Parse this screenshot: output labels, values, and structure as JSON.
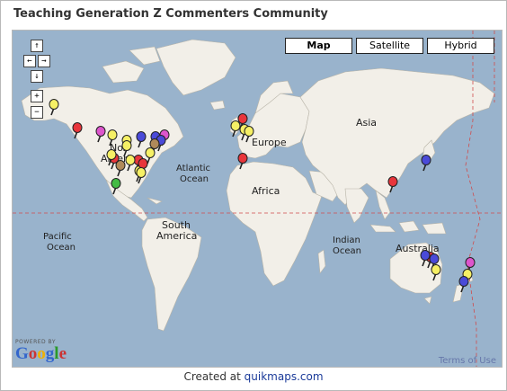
{
  "title": "Teaching Generation Z Commenters Community",
  "map_types": [
    "Map",
    "Satellite",
    "Hybrid"
  ],
  "active_map_type": "Map",
  "nav": {
    "up": "↑",
    "left": "←",
    "right": "→",
    "down": "↓",
    "zoom_in": "+",
    "zoom_out": "−"
  },
  "labels": {
    "asia": "Asia",
    "europe": "Europe",
    "africa": "Africa",
    "north_america_1": "No",
    "north_america_2": "America",
    "atlantic_1": "Atlantic",
    "atlantic_2": "Ocean",
    "pacific_1": "Pacific",
    "pacific_2": "Ocean",
    "south_america_1": "South",
    "south_america_2": "America",
    "indian_1": "Indian",
    "indian_2": "Ocean",
    "australia": "Australia"
  },
  "google": {
    "powered": "POWERED BY",
    "logo": "Google",
    "colors": [
      "#3366cc",
      "#cc3333",
      "#f0b000",
      "#3366cc",
      "#2a9a2a",
      "#cc3333"
    ]
  },
  "terms": "Terms of Use",
  "footer": {
    "prefix": "Created at",
    "link": "quikmaps.com"
  },
  "marker_colors": {
    "red": "#e8353b",
    "yellow": "#f6f065",
    "blue": "#4a4ad8",
    "magenta": "#dd55cc",
    "green": "#44bb44",
    "brown": "#b08a5a"
  },
  "markers": [
    {
      "color": "yellow",
      "region": "Alaska"
    },
    {
      "color": "red",
      "region": "US West"
    },
    {
      "color": "magenta",
      "region": "US West"
    },
    {
      "color": "yellow",
      "region": "US West"
    },
    {
      "color": "yellow",
      "region": "US West"
    },
    {
      "color": "red",
      "region": "US Central"
    },
    {
      "color": "yellow",
      "region": "US Central"
    },
    {
      "color": "brown",
      "region": "US Central"
    },
    {
      "color": "blue",
      "region": "US North"
    },
    {
      "color": "yellow",
      "region": "US Central"
    },
    {
      "color": "red",
      "region": "US East"
    },
    {
      "color": "blue",
      "region": "US East"
    },
    {
      "color": "magenta",
      "region": "US East"
    },
    {
      "color": "blue",
      "region": "US East"
    },
    {
      "color": "brown",
      "region": "US East"
    },
    {
      "color": "yellow",
      "region": "US East"
    },
    {
      "color": "yellow",
      "region": "US East"
    },
    {
      "color": "red",
      "region": "US South"
    },
    {
      "color": "yellow",
      "region": "US South"
    },
    {
      "color": "yellow",
      "region": "US South"
    },
    {
      "color": "green",
      "region": "Mexico"
    },
    {
      "color": "red",
      "region": "UK"
    },
    {
      "color": "yellow",
      "region": "UK"
    },
    {
      "color": "yellow",
      "region": "Europe"
    },
    {
      "color": "yellow",
      "region": "Europe"
    },
    {
      "color": "red",
      "region": "Iberia"
    },
    {
      "color": "red",
      "region": "Southeast Asia"
    },
    {
      "color": "blue",
      "region": "Japan"
    },
    {
      "color": "red",
      "region": "Australia"
    },
    {
      "color": "blue",
      "region": "Australia"
    },
    {
      "color": "blue",
      "region": "Australia"
    },
    {
      "color": "yellow",
      "region": "Australia"
    },
    {
      "color": "magenta",
      "region": "New Zealand"
    },
    {
      "color": "yellow",
      "region": "New Zealand"
    },
    {
      "color": "blue",
      "region": "New Zealand"
    }
  ]
}
